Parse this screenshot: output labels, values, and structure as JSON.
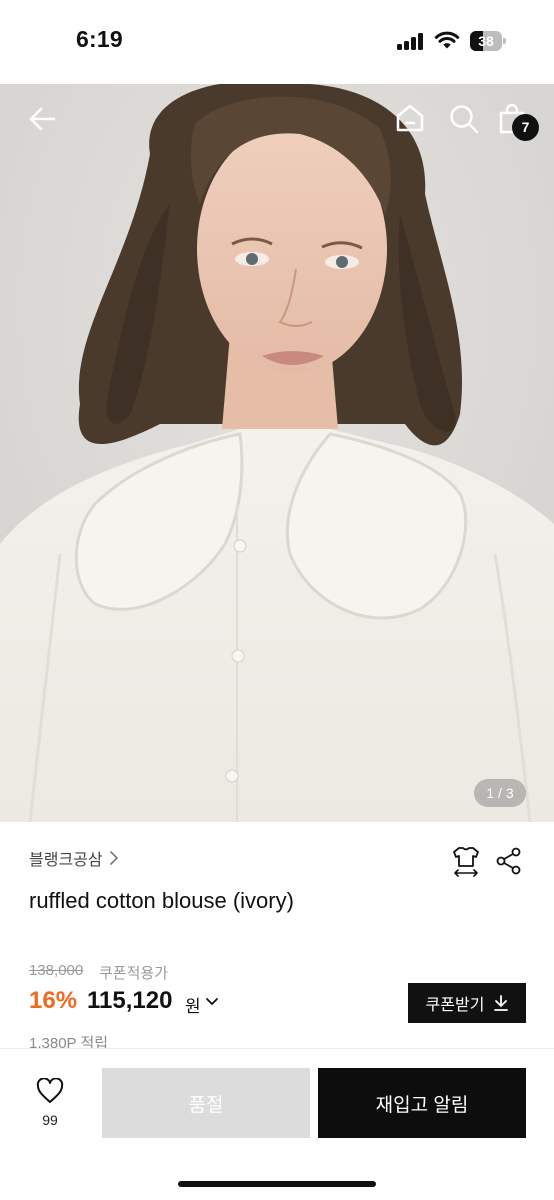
{
  "status_bar": {
    "time": "6:19",
    "battery_level": "38",
    "icons": [
      "signal-icon",
      "wifi-icon",
      "battery-icon"
    ]
  },
  "top_nav": {
    "icons": [
      "back-arrow-icon",
      "home-icon",
      "search-icon",
      "shopping-bag-icon"
    ],
    "cart_count": "7"
  },
  "gallery": {
    "page_indicator": "1 / 3",
    "image_description_icon": "product-photo"
  },
  "product": {
    "brand": "블랭크공삼",
    "name": "ruffled cotton blouse (ivory)",
    "original_price": "138,000",
    "coupon_price_label": "쿠폰적용가",
    "discount_rate": "16%",
    "sale_price": "115,120",
    "currency": "원",
    "coupon_button_label": "쿠폰받기",
    "points": "1,380P 적립",
    "action_icons": [
      "size-guide-icon",
      "share-icon"
    ]
  },
  "bottom_bar": {
    "like_count": "99",
    "soldout_label": "품절",
    "restock_label": "재입고 알림"
  },
  "colors": {
    "accent_discount": "#f06a1d",
    "primary_dark": "#0d0d0d",
    "disabled_button": "#dcdcdc"
  }
}
